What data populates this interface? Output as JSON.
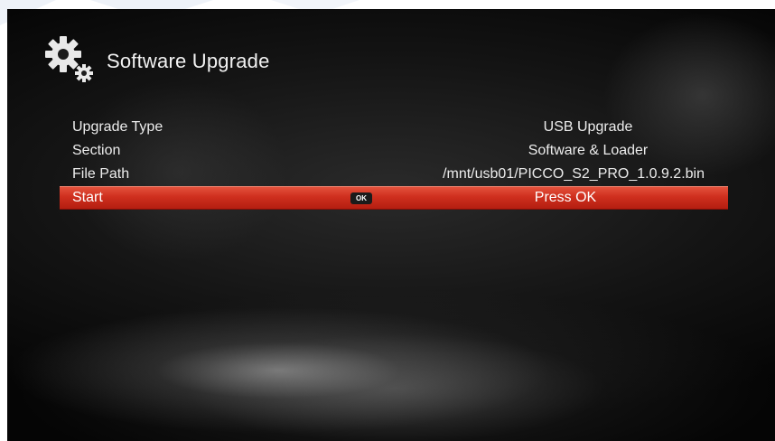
{
  "header": {
    "title": "Software Upgrade",
    "icon": "gear-icon"
  },
  "menu": {
    "rows": [
      {
        "label": "Upgrade Type",
        "value": "USB Upgrade"
      },
      {
        "label": "Section",
        "value": "Software & Loader"
      },
      {
        "label": "File Path",
        "value": "/mnt/usb01/PICCO_S2_PRO_1.0.9.2.bin"
      },
      {
        "label": "Start",
        "key_hint": "OK",
        "value": "Press OK",
        "selected": true
      }
    ]
  },
  "colors": {
    "highlight": "#cf2f1e",
    "background": "#141414",
    "text": "#ededed"
  }
}
